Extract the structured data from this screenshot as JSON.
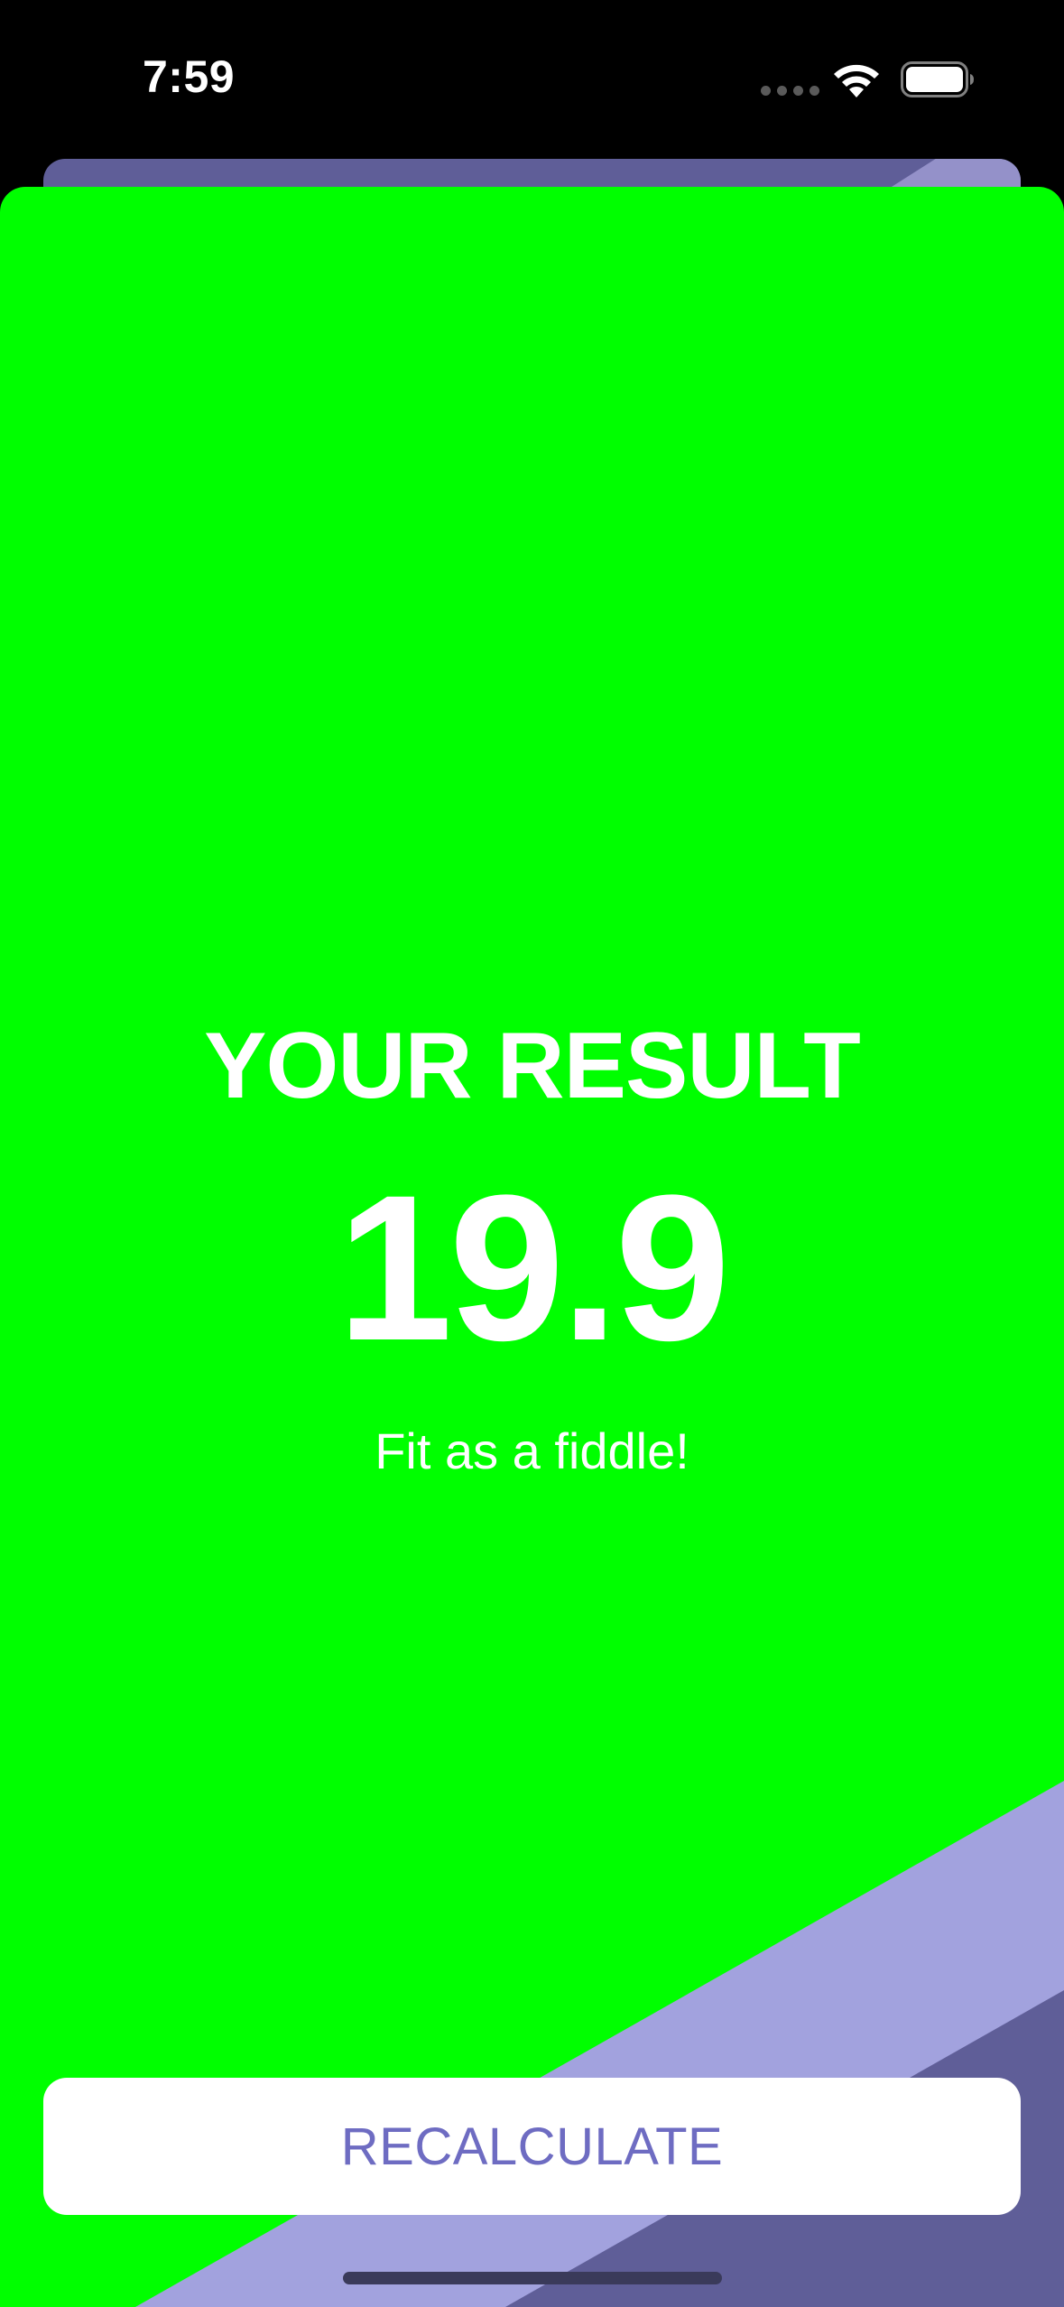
{
  "status_bar": {
    "time": "7:59",
    "icons": [
      "signal-dots-icon",
      "wifi-icon",
      "battery-icon"
    ]
  },
  "result": {
    "title": "YOUR RESULT",
    "value": "19.9",
    "advice": "Fit as a fiddle!"
  },
  "actions": {
    "recalculate_label": "RECALCULATE"
  },
  "colors": {
    "background_result": "#00ff00",
    "accent": "#6e6cc2",
    "stripe_light": "#a2a2de",
    "stripe_dark": "#5f5e98",
    "button_bg": "#ffffff",
    "text": "#ffffff"
  }
}
